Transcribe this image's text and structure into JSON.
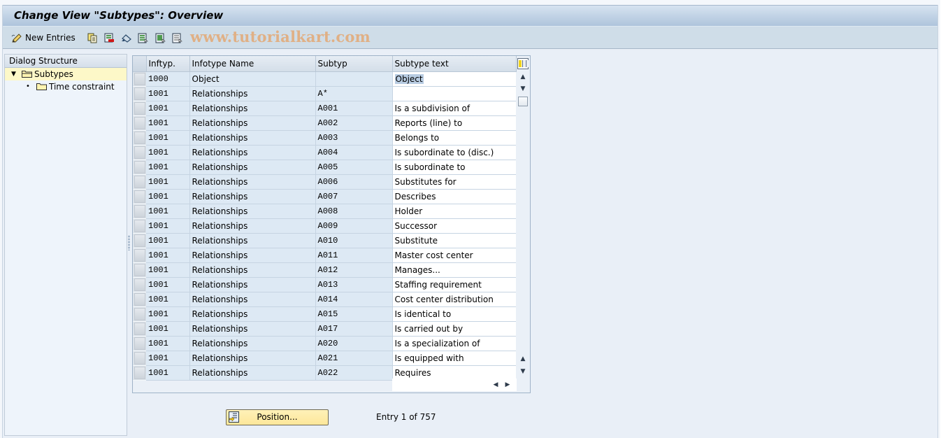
{
  "window": {
    "title": "Change View \"Subtypes\": Overview"
  },
  "toolbar": {
    "new_entries_label": "New Entries",
    "icons": [
      "edit-pencil-icon",
      "copy-icon",
      "delete-icon",
      "undo-icon",
      "select-all-icon",
      "select-block-icon",
      "deselect-all-icon"
    ],
    "watermark": "www.tutorialkart.com"
  },
  "dialog_structure": {
    "header": "Dialog Structure",
    "items": [
      {
        "label": "Subtypes",
        "selected": true,
        "expanded": true,
        "level": 0
      },
      {
        "label": "Time constraint",
        "selected": false,
        "level": 1
      }
    ]
  },
  "table": {
    "columns": [
      "Inftyp.",
      "Infotype Name",
      "Subtyp",
      "Subtype text"
    ],
    "rows": [
      {
        "inftyp": "1000",
        "name": "Object",
        "subtyp": "",
        "text": "Object",
        "highlight": true
      },
      {
        "inftyp": "1001",
        "name": "Relationships",
        "subtyp": "A*",
        "text": ""
      },
      {
        "inftyp": "1001",
        "name": "Relationships",
        "subtyp": "A001",
        "text": "Is a subdivision of"
      },
      {
        "inftyp": "1001",
        "name": "Relationships",
        "subtyp": "A002",
        "text": "Reports (line) to"
      },
      {
        "inftyp": "1001",
        "name": "Relationships",
        "subtyp": "A003",
        "text": "Belongs to"
      },
      {
        "inftyp": "1001",
        "name": "Relationships",
        "subtyp": "A004",
        "text": "Is subordinate to (disc.)"
      },
      {
        "inftyp": "1001",
        "name": "Relationships",
        "subtyp": "A005",
        "text": "Is subordinate to"
      },
      {
        "inftyp": "1001",
        "name": "Relationships",
        "subtyp": "A006",
        "text": "Substitutes for"
      },
      {
        "inftyp": "1001",
        "name": "Relationships",
        "subtyp": "A007",
        "text": "Describes"
      },
      {
        "inftyp": "1001",
        "name": "Relationships",
        "subtyp": "A008",
        "text": "Holder"
      },
      {
        "inftyp": "1001",
        "name": "Relationships",
        "subtyp": "A009",
        "text": "Successor"
      },
      {
        "inftyp": "1001",
        "name": "Relationships",
        "subtyp": "A010",
        "text": "Substitute"
      },
      {
        "inftyp": "1001",
        "name": "Relationships",
        "subtyp": "A011",
        "text": "Master cost center"
      },
      {
        "inftyp": "1001",
        "name": "Relationships",
        "subtyp": "A012",
        "text": "Manages..."
      },
      {
        "inftyp": "1001",
        "name": "Relationships",
        "subtyp": "A013",
        "text": "Staffing requirement"
      },
      {
        "inftyp": "1001",
        "name": "Relationships",
        "subtyp": "A014",
        "text": "Cost center distribution"
      },
      {
        "inftyp": "1001",
        "name": "Relationships",
        "subtyp": "A015",
        "text": "Is identical to"
      },
      {
        "inftyp": "1001",
        "name": "Relationships",
        "subtyp": "A017",
        "text": "Is carried out by"
      },
      {
        "inftyp": "1001",
        "name": "Relationships",
        "subtyp": "A020",
        "text": "Is a specialization of"
      },
      {
        "inftyp": "1001",
        "name": "Relationships",
        "subtyp": "A021",
        "text": "Is equipped with"
      },
      {
        "inftyp": "1001",
        "name": "Relationships",
        "subtyp": "A022",
        "text": "Requires"
      }
    ]
  },
  "footer": {
    "position_button_label": "Position...",
    "entry_info": "Entry 1 of 757"
  },
  "colors": {
    "title_bar": "#aec4dc",
    "toolbar": "#cfdde8",
    "selected_nav": "#fdf8c8",
    "position_button": "#fde79a",
    "highlight": "#b8cce2"
  }
}
